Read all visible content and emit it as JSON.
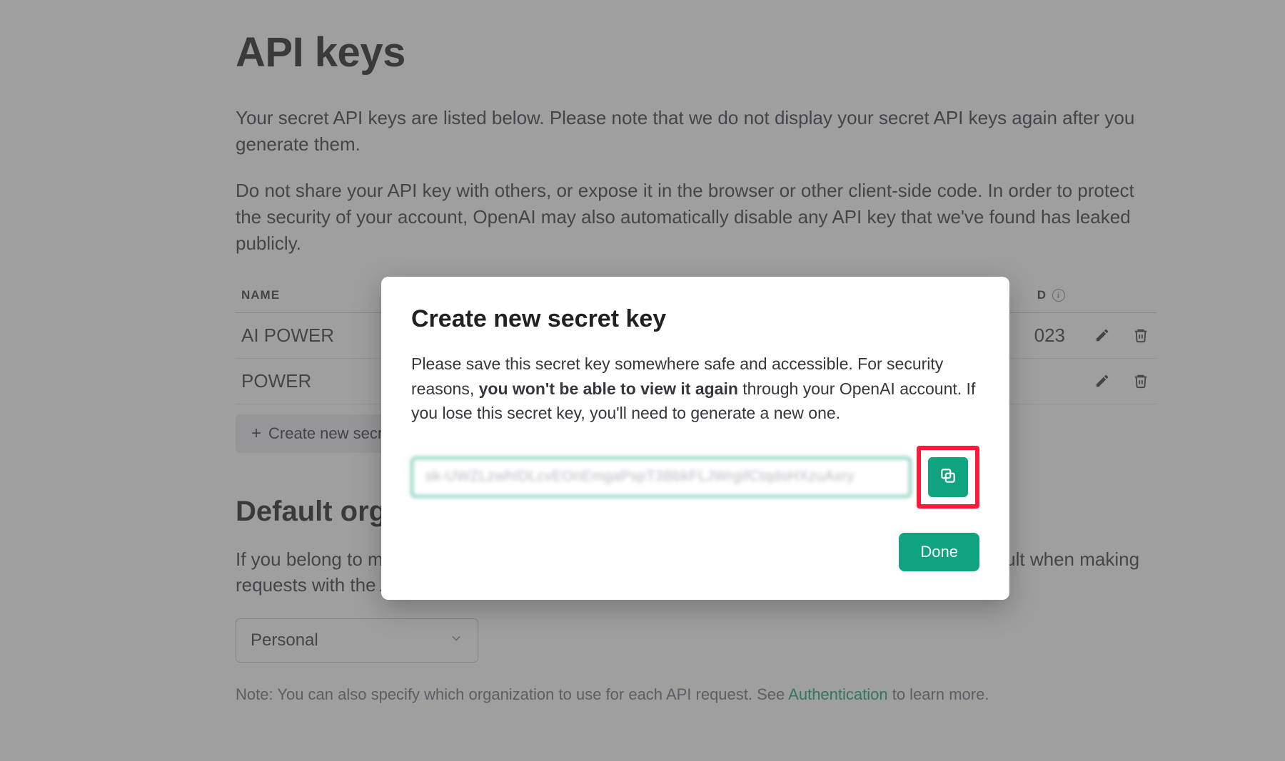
{
  "page": {
    "title": "API keys",
    "intro1": "Your secret API keys are listed below. Please note that we do not display your secret API keys again after you generate them.",
    "intro2": "Do not share your API key with others, or expose it in the browser or other client-side code. In order to protect the security of your account, OpenAI may also automatically disable any API key that we've found has leaked publicly."
  },
  "table": {
    "headers": {
      "name": "NAME",
      "last_used": "D"
    },
    "rows": [
      {
        "name": "AI POWER",
        "last_used": "023"
      },
      {
        "name": "POWER",
        "last_used": ""
      }
    ]
  },
  "buttons": {
    "create_key": "Create new secret key"
  },
  "org": {
    "heading": "Default organization",
    "desc": "If you belong to multiple organizations, this setting controls which organization is used by default when making requests with the API keys above.",
    "selected": "Personal"
  },
  "note": {
    "prefix": "Note: You can also specify which organization to use for each API request. See ",
    "link": "Authentication",
    "suffix": " to learn more."
  },
  "modal": {
    "title": "Create new secret key",
    "body_pre": "Please save this secret key somewhere safe and accessible. For security reasons, ",
    "body_bold": "you won't be able to view it again",
    "body_post": " through your OpenAI account. If you lose this secret key, you'll need to generate a new one.",
    "key_value": "sk-UWZLzwhIDLcvEOnEmgaPspT3BbkFLJWrgifCtqdsHXzuAxry",
    "done": "Done"
  },
  "colors": {
    "accent": "#10a37f",
    "highlight_border": "#ff1a3c"
  }
}
